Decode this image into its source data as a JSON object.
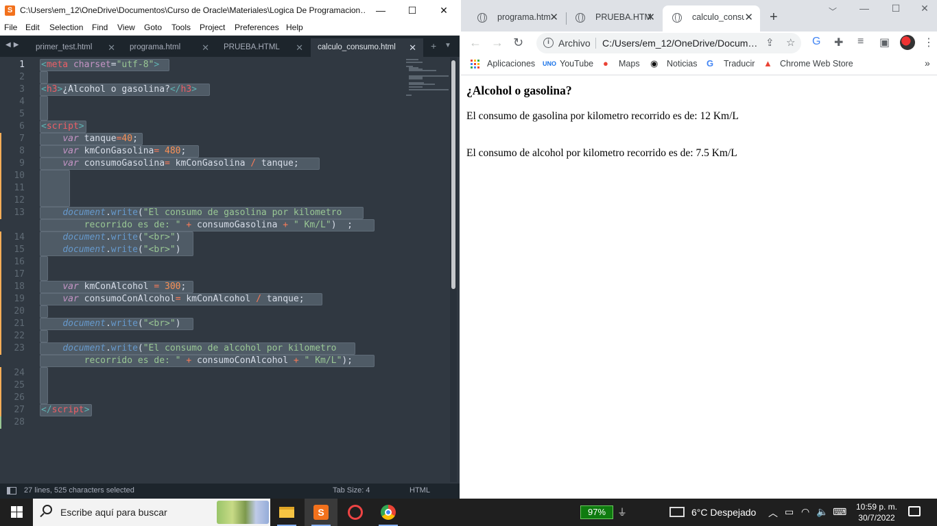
{
  "sublime": {
    "title": "C:\\Users\\em_12\\OneDrive\\Documentos\\Curso de Oracle\\Materiales\\Logica De Programacion…",
    "logo": "S",
    "window_controls": {
      "minimize": "—",
      "maximize": "☐",
      "close": "✕"
    },
    "menu": [
      "File",
      "Edit",
      "Selection",
      "Find",
      "View",
      "Goto",
      "Tools",
      "Project",
      "Preferences",
      "Help"
    ],
    "tabs": [
      {
        "label": "primer_test.html",
        "active": false
      },
      {
        "label": "programa.html",
        "active": false
      },
      {
        "label": "PRUEBA.HTML",
        "active": false
      },
      {
        "label": "calculo_consumo.html",
        "active": true
      }
    ],
    "tab_close": "✕",
    "tab_nav": "◀▶",
    "tab_new": "+",
    "tab_more": "▼",
    "line_numbers": [
      "1",
      "2",
      "3",
      "4",
      "5",
      "6",
      "7",
      "8",
      "9",
      "10",
      "11",
      "12",
      "13",
      "",
      "14",
      "15",
      "16",
      "17",
      "18",
      "19",
      "20",
      "21",
      "22",
      "23",
      "",
      "24",
      "25",
      "26",
      "27",
      "28"
    ],
    "current_line": "1",
    "status": {
      "selection": "27 lines, 525 characters selected",
      "tab_size": "Tab Size: 4",
      "syntax": "HTML"
    },
    "colors": {
      "background": "#303841",
      "tag": "#ec5f67",
      "string": "#99c794",
      "keyword": "#c594c5",
      "number": "#f99157",
      "object": "#6699cc",
      "selection": "#4f5b66"
    }
  },
  "chrome": {
    "tabs": [
      {
        "label": "programa.html",
        "active": false
      },
      {
        "label": "PRUEBA.HTML",
        "active": false
      },
      {
        "label": "calculo_consum",
        "active": true
      }
    ],
    "tab_close": "✕",
    "new_tab": "+",
    "address": {
      "scheme_label": "Archivo",
      "url": "C:/Users/em_12/OneDrive/Docum…"
    },
    "bookmarks": [
      {
        "label": "Aplicaciones",
        "icon": "apps-grid-icon"
      },
      {
        "label": "YouTube",
        "icon": "uno-icon"
      },
      {
        "label": "Maps",
        "icon": "maps-pin-icon"
      },
      {
        "label": "Noticias",
        "icon": "github-icon"
      },
      {
        "label": "Traducir",
        "icon": "translate-icon"
      },
      {
        "label": "Chrome Web Store",
        "icon": "web-store-icon"
      }
    ],
    "bookmarks_more": "»",
    "page": {
      "heading": "¿Alcohol o gasolina?",
      "line1": "El consumo de gasolina por kilometro recorrido es de: 12 Km/L",
      "line2": "El consumo de alcohol por kilometro recorrido es de: 7.5 Km/L"
    }
  },
  "taskbar": {
    "search_placeholder": "Escribe aquí para buscar",
    "battery": "97%",
    "weather": "6°C  Despejado",
    "time": "10:59 p. m.",
    "date": "30/7/2022"
  }
}
